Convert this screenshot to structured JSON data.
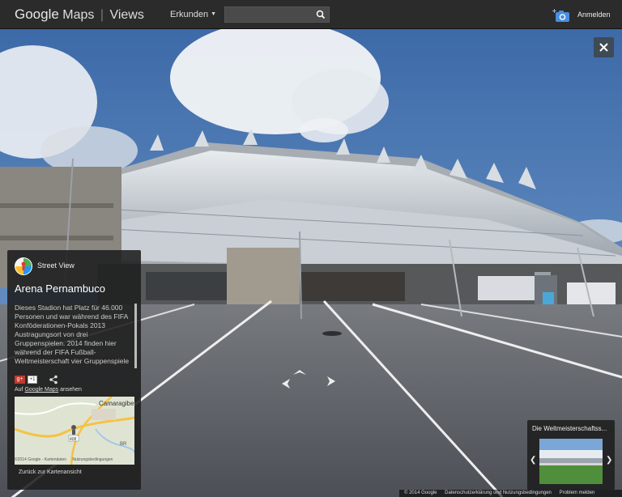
{
  "topbar": {
    "brand_google": "Google",
    "brand_maps": "Maps",
    "brand_separator": "|",
    "brand_views": "Views",
    "explore_label": "Erkunden",
    "search_placeholder": "",
    "signin_label": "Anmelden"
  },
  "panel": {
    "streetview_label": "Street View",
    "place_title": "Arena Pernambuco",
    "description": "Dieses Stadion hat Platz für 46.000 Personen und war während des FIFA Konföderationen-Pokals 2013 Austragungsort von drei Gruppenspielen. 2014 finden hier während der FIFA Fußball-Weltmeisterschaft vier Gruppenspiele",
    "gplus_label": "g+",
    "plusone_label": "+1",
    "link_prefix": "Auf",
    "link_text": "Google Maps",
    "link_suffix": "ansehen",
    "map_place_label": "Camaragibe",
    "map_road_label": "408",
    "map_road_label_2": "BR",
    "map_copyright": "©2014 Google - Kartendaten",
    "map_terms": "Nutzungsbedingungen",
    "back_to_map": "Zurück zur Kartenansicht"
  },
  "thumbnail": {
    "title": "Die Weltmeisterschaftss..."
  },
  "footer": {
    "copyright": "© 2014 Google",
    "privacy": "Datenschutzerklärung und Nutzungsbedingungen",
    "report": "Problem melden"
  },
  "colors": {
    "topbar_bg": "#2b2b2b",
    "panel_bg": "#1e1e1e",
    "close_bg": "#3e4a55",
    "sky": "#4a74b0",
    "ground": "#5c6066"
  }
}
